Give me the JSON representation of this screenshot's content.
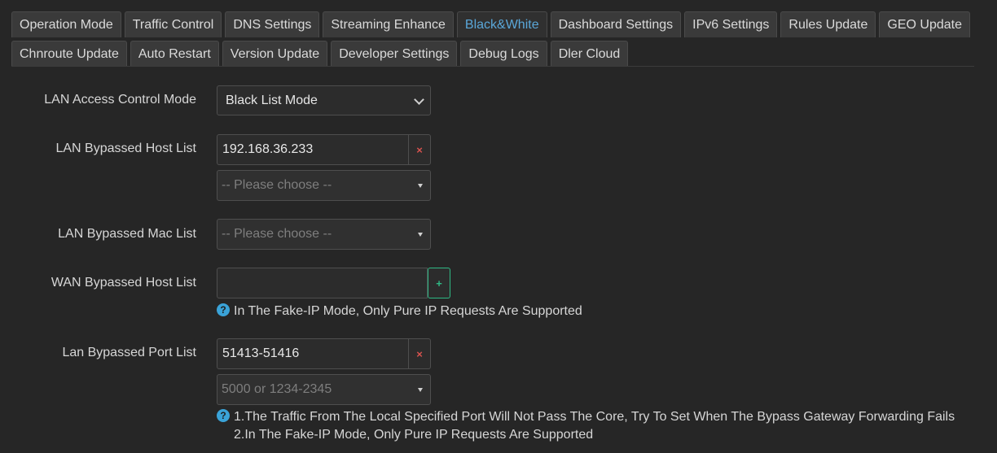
{
  "tabs_row1": [
    {
      "label": "Operation Mode",
      "active": false
    },
    {
      "label": "Traffic Control",
      "active": false
    },
    {
      "label": "DNS Settings",
      "active": false
    },
    {
      "label": "Streaming Enhance",
      "active": false
    },
    {
      "label": "Black&White",
      "active": true
    },
    {
      "label": "Dashboard Settings",
      "active": false
    },
    {
      "label": "IPv6 Settings",
      "active": false
    },
    {
      "label": "Rules Update",
      "active": false
    },
    {
      "label": "GEO Update",
      "active": false
    }
  ],
  "tabs_row2": [
    {
      "label": "Chnroute Update",
      "active": false
    },
    {
      "label": "Auto Restart",
      "active": false
    },
    {
      "label": "Version Update",
      "active": false
    },
    {
      "label": "Developer Settings",
      "active": false
    },
    {
      "label": "Debug Logs",
      "active": false
    },
    {
      "label": "Dler Cloud",
      "active": false
    }
  ],
  "lan_access": {
    "label": "LAN Access Control Mode",
    "value": "Black List Mode"
  },
  "lan_host": {
    "label": "LAN Bypassed Host List",
    "value": "192.168.36.233",
    "remove_icon": "×",
    "choose_placeholder": "-- Please choose --"
  },
  "lan_mac": {
    "label": "LAN Bypassed Mac List",
    "choose_placeholder": "-- Please choose --"
  },
  "wan_host": {
    "label": "WAN Bypassed Host List",
    "value": "",
    "add_icon": "+",
    "hint": "In The Fake-IP Mode, Only Pure IP Requests Are Supported"
  },
  "lan_port": {
    "label": "Lan Bypassed Port List",
    "value": "51413-51416",
    "remove_icon": "×",
    "placeholder": "5000 or 1234-2345",
    "hint1": "1.The Traffic From The Local Specified Port Will Not Pass The Core, Try To Set When The Bypass Gateway Forwarding Fails",
    "hint2": "2.In The Fake-IP Mode, Only Pure IP Requests Are Supported"
  },
  "help_icon": "?"
}
